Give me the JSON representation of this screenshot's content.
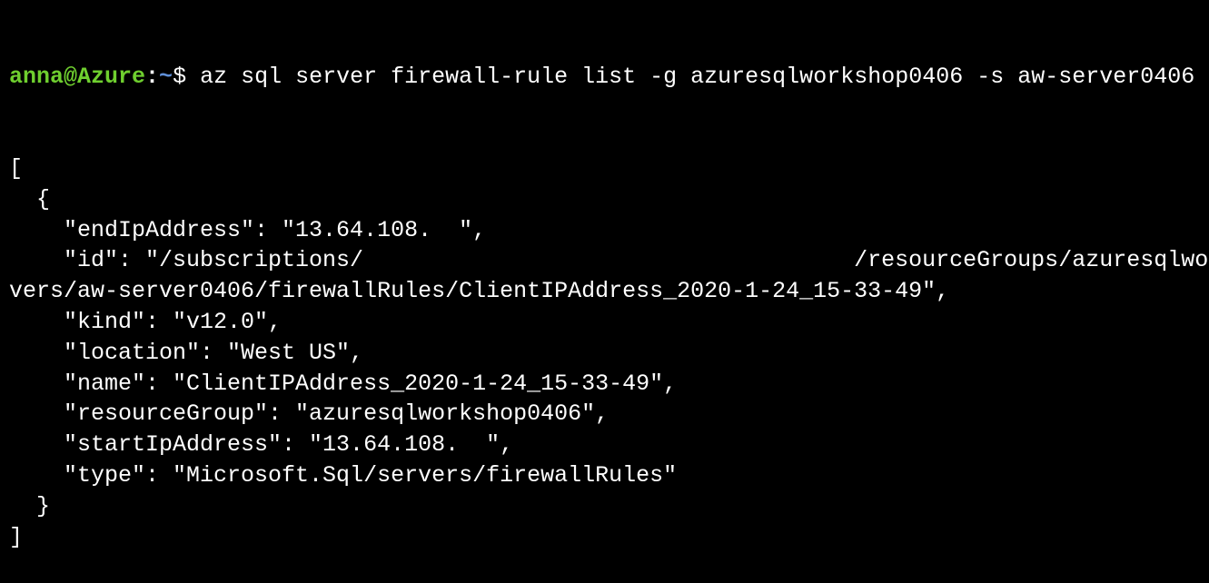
{
  "prompt": {
    "user_host": "anna@Azure",
    "colon": ":",
    "path": "~",
    "symbol": "$ ",
    "command": "az sql server firewall-rule list -g azuresqlworkshop0406 -s aw-server0406"
  },
  "output_lines": [
    "[",
    "  {",
    "    \"endIpAddress\": \"13.64.108.  \",",
    "    \"id\": \"/subscriptions/                                    /resourceGroups/azuresqlwo",
    "vers/aw-server0406/firewallRules/ClientIPAddress_2020-1-24_15-33-49\",",
    "    \"kind\": \"v12.0\",",
    "    \"location\": \"West US\",",
    "    \"name\": \"ClientIPAddress_2020-1-24_15-33-49\",",
    "    \"resourceGroup\": \"azuresqlworkshop0406\",",
    "    \"startIpAddress\": \"13.64.108.  \",",
    "    \"type\": \"Microsoft.Sql/servers/firewallRules\"",
    "  }",
    "]"
  ],
  "colors": {
    "background": "#000000",
    "text": "#ffffff",
    "user": "#6fcf2f",
    "path": "#5f8fd8"
  }
}
